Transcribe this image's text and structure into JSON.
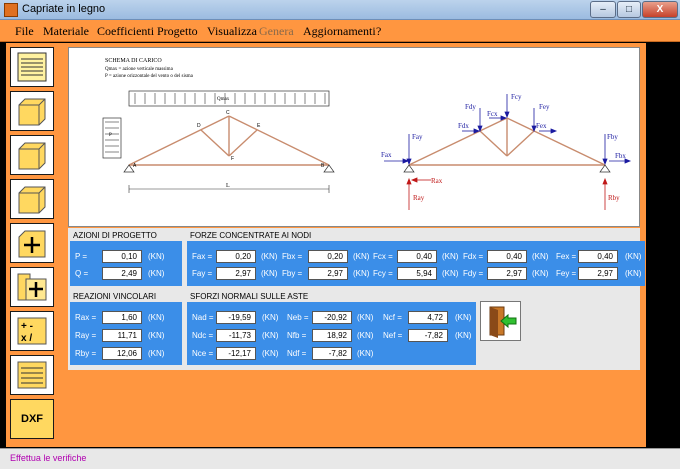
{
  "window": {
    "title": "Capriate in legno",
    "min_label": "–",
    "max_label": "□",
    "close_label": "X"
  },
  "menu": [
    {
      "label": "File",
      "enabled": true
    },
    {
      "label": "Materiale",
      "enabled": true
    },
    {
      "label": "Coefficienti",
      "enabled": true
    },
    {
      "label": "Progetto",
      "enabled": true
    },
    {
      "label": "Visualizza",
      "enabled": true
    },
    {
      "label": "Genera",
      "enabled": false
    },
    {
      "label": "Aggiornamenti",
      "enabled": true
    },
    {
      "label": "?",
      "enabled": true
    }
  ],
  "toolbar": {
    "tools": [
      "document-lines-icon",
      "box-icon",
      "box-icon",
      "box-icon",
      "plus-icon",
      "folder-plus-icon",
      "calculator-icon",
      "list-icon",
      "dxf-icon"
    ],
    "dxf_label": "DXF"
  },
  "diagram": {
    "title": "SCHEMA DI CARICO",
    "legend_q": "Qmax = azione verticale massima",
    "legend_p": "P = azione orizzontale del vento o del sisma",
    "load_label": "Qmax",
    "p_label": "P",
    "length_label": "L",
    "nodes": {
      "a": "A",
      "b": "B",
      "c": "C",
      "d": "D",
      "e": "E",
      "f": "F"
    },
    "forces": {
      "fax": "Fax",
      "fay": "Fay",
      "fdx": "Fdx",
      "fdy": "Fdy",
      "fcx": "Fcx",
      "fcy": "Fcy",
      "fex": "Fex",
      "fey": "Fey",
      "fbx": "Fbx",
      "fby": "Fby",
      "rax": "Rax",
      "ray": "Ray",
      "rby": "Rby"
    }
  },
  "azioni": {
    "title": "AZIONI DI PROGETTO",
    "rows": [
      {
        "label": "P =",
        "value": "0,10",
        "unit": "(KN)"
      },
      {
        "label": "Q =",
        "value": "2,49",
        "unit": "(KN)"
      }
    ]
  },
  "forze": {
    "title": "FORZE CONCENTRATE AI NODI",
    "rows": [
      [
        {
          "label": "Fax =",
          "value": "0,20",
          "unit": "(KN)"
        },
        {
          "label": "Fbx =",
          "value": "0,20",
          "unit": "(KN)"
        },
        {
          "label": "Fcx =",
          "value": "0,40",
          "unit": "(KN)"
        },
        {
          "label": "Fdx =",
          "value": "0,40",
          "unit": "(KN)"
        },
        {
          "label": "Fex =",
          "value": "0,40",
          "unit": "(KN)"
        }
      ],
      [
        {
          "label": "Fay =",
          "value": "2,97",
          "unit": "(KN)"
        },
        {
          "label": "Fby =",
          "value": "2,97",
          "unit": "(KN)"
        },
        {
          "label": "Fcy =",
          "value": "5,94",
          "unit": "(KN)"
        },
        {
          "label": "Fdy =",
          "value": "2,97",
          "unit": "(KN)"
        },
        {
          "label": "Fey =",
          "value": "2,97",
          "unit": "(KN)"
        }
      ]
    ]
  },
  "reazioni": {
    "title": "REAZIONI VINCOLARI",
    "rows": [
      {
        "label": "Rax =",
        "value": "1,60",
        "unit": "(KN)"
      },
      {
        "label": "Ray =",
        "value": "11,71",
        "unit": "(KN)"
      },
      {
        "label": "Rby =",
        "value": "12,06",
        "unit": "(KN)"
      }
    ]
  },
  "sforzi": {
    "title": "SFORZI NORMALI SULLE ASTE",
    "rows": [
      [
        {
          "label": "Nad =",
          "value": "-19,59",
          "unit": "(KN)"
        },
        {
          "label": "Neb =",
          "value": "-20,92",
          "unit": "(KN)"
        },
        {
          "label": "Ncf =",
          "value": "4,72",
          "unit": "(KN)"
        }
      ],
      [
        {
          "label": "Ndc =",
          "value": "-11,73",
          "unit": "(KN)"
        },
        {
          "label": "Nfb =",
          "value": "18,92",
          "unit": "(KN)"
        },
        {
          "label": "Nef =",
          "value": "-7,82",
          "unit": "(KN)"
        }
      ],
      [
        {
          "label": "Nce =",
          "value": "-12,17",
          "unit": "(KN)"
        },
        {
          "label": "Ndf =",
          "value": "-7,82",
          "unit": "(KN)"
        }
      ]
    ]
  },
  "exit_button": {
    "icon": "exit-door-icon"
  },
  "status": {
    "text": "Effettua le verifiche"
  },
  "colors": {
    "accent": "#ff9640",
    "panel_blue": "#3b8ee8",
    "truss": "#c88c6e",
    "force_blue": "#1a1aa0",
    "reaction_red": "#c01818",
    "status_text": "#b000b0"
  }
}
